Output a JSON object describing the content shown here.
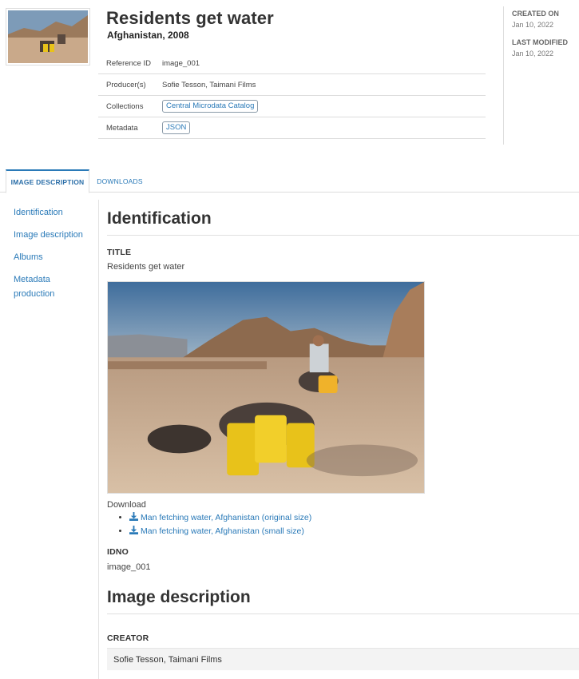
{
  "header": {
    "title": "Residents get water",
    "subtitle": "Afghanistan, 2008",
    "meta": {
      "reference_label": "Reference ID",
      "reference_value": "image_001",
      "producers_label": "Producer(s)",
      "producers_value": "Sofie Tesson, Taimani Films",
      "collections_label": "Collections",
      "collections_value": "Central Microdata Catalog",
      "metadata_label": "Metadata",
      "metadata_value": "JSON"
    },
    "created_label": "CREATED ON",
    "created_value": "Jan 10, 2022",
    "modified_label": "LAST MODIFIED",
    "modified_value": "Jan 10, 2022"
  },
  "tabs": {
    "image_description": "IMAGE DESCRIPTION",
    "downloads": "DOWNLOADS"
  },
  "sidenav": {
    "identification": "Identification",
    "image_description": "Image description",
    "albums": "Albums",
    "metadata_production": "Metadata production"
  },
  "main": {
    "identification_heading": "Identification",
    "title_label": "TITLE",
    "title_value": "Residents get water",
    "download_label": "Download",
    "download_original": "Man fetching water, Afghanistan (original size)",
    "download_small": "Man fetching water, Afghanistan (small size)",
    "idno_label": "IDNO",
    "idno_value": "image_001",
    "image_description_heading": "Image description",
    "creator_label": "CREATOR",
    "creator_value": "Sofie Tesson, Taimani Films"
  },
  "colors": {
    "link": "#2a7ab8",
    "accent_tab": "#2a7ab8"
  }
}
